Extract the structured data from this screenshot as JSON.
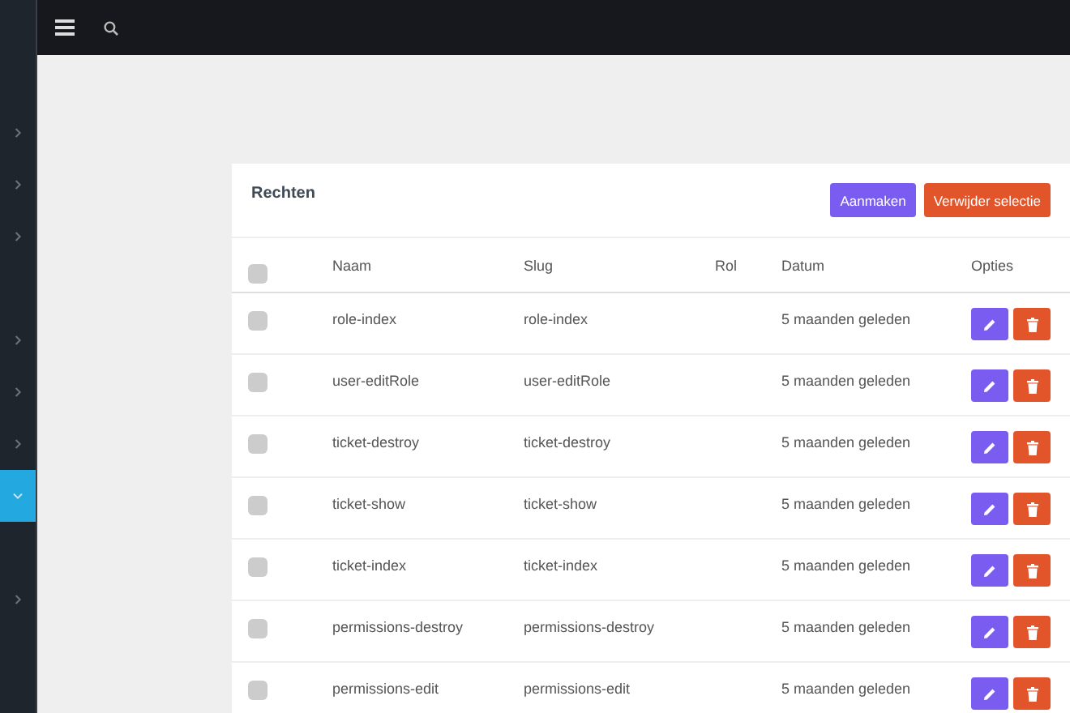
{
  "sidebar": {
    "items": [
      {
        "kind": "link",
        "selected": false,
        "expanded": false
      },
      {
        "kind": "link",
        "selected": false,
        "expanded": false
      },
      {
        "kind": "link",
        "selected": false,
        "expanded": false
      },
      {
        "kind": "spacer"
      },
      {
        "kind": "link",
        "selected": false,
        "expanded": false
      },
      {
        "kind": "link",
        "selected": false,
        "expanded": false
      },
      {
        "kind": "link",
        "selected": false,
        "expanded": false
      },
      {
        "kind": "link",
        "selected": true,
        "expanded": true
      },
      {
        "kind": "spacer"
      },
      {
        "kind": "link",
        "selected": false,
        "expanded": false
      }
    ]
  },
  "card": {
    "title": "Rechten",
    "buttons": [
      {
        "label": "Aanmaken",
        "kind": "create"
      },
      {
        "label": "Verwijder selectie",
        "kind": "delete"
      }
    ],
    "table": {
      "select_all": {
        "checked": false
      },
      "columns": [
        "Naam",
        "Slug",
        "Rol",
        "Datum",
        "Opties"
      ],
      "rows": [
        {
          "checked": false,
          "naam": "role-index",
          "slug": "role-index",
          "rol": "",
          "datum": "5 maanden geleden"
        },
        {
          "checked": false,
          "naam": "user-editRole",
          "slug": "user-editRole",
          "rol": "",
          "datum": "5 maanden geleden"
        },
        {
          "checked": false,
          "naam": "ticket-destroy",
          "slug": "ticket-destroy",
          "rol": "",
          "datum": "5 maanden geleden"
        },
        {
          "checked": false,
          "naam": "ticket-show",
          "slug": "ticket-show",
          "rol": "",
          "datum": "5 maanden geleden"
        },
        {
          "checked": false,
          "naam": "ticket-index",
          "slug": "ticket-index",
          "rol": "",
          "datum": "5 maanden geleden"
        },
        {
          "checked": false,
          "naam": "permissions-destroy",
          "slug": "permissions-destroy",
          "rol": "",
          "datum": "5 maanden geleden"
        },
        {
          "checked": false,
          "naam": "permissions-edit",
          "slug": "permissions-edit",
          "rol": "",
          "datum": "5 maanden geleden"
        }
      ]
    }
  }
}
